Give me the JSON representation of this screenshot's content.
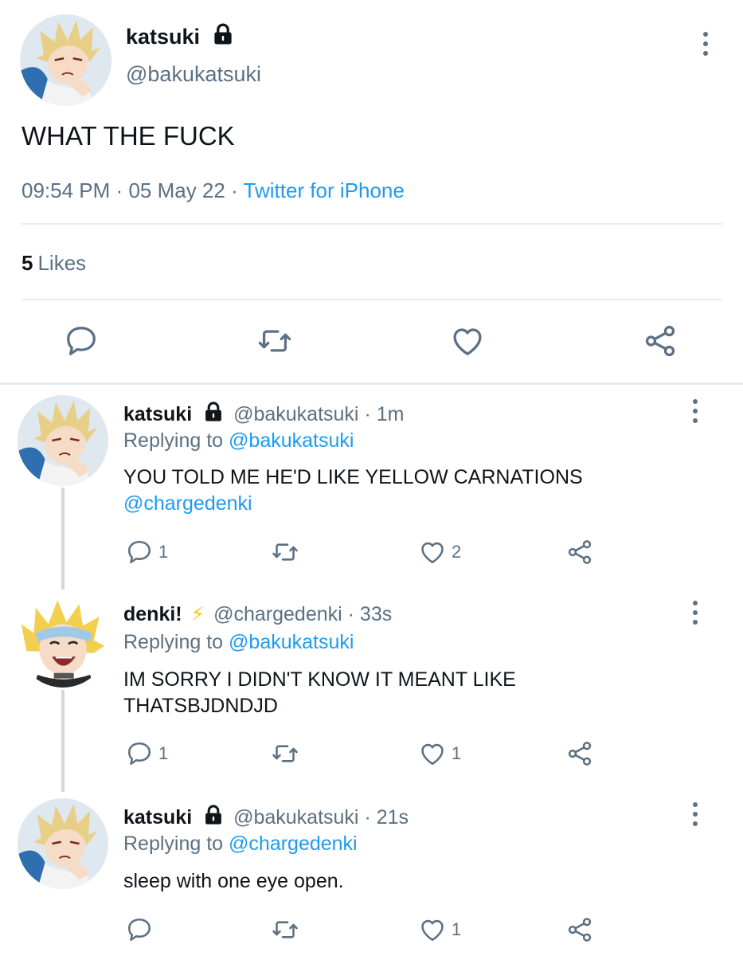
{
  "main_tweet": {
    "name": "katsuki",
    "handle": "@bakukatsuki",
    "text": "WHAT THE FUCK",
    "time": "09:54 PM",
    "date": "05 May 22",
    "client": "Twitter for iPhone",
    "likes_count": "5",
    "likes_label": "Likes"
  },
  "replies": [
    {
      "name": "katsuki",
      "handle": "@bakukatsuki",
      "age": "1m",
      "replying_label": "Replying to",
      "replying_to": "@bakukatsuki",
      "text": "YOU TOLD ME HE'D LIKE YELLOW CARNATIONS",
      "mention": "@chargedenki",
      "reply_count": "1",
      "like_count": "2"
    },
    {
      "name": "denki!",
      "emoji": "⚡",
      "handle": "@chargedenki",
      "age": "33s",
      "replying_label": "Replying to",
      "replying_to": "@bakukatsuki",
      "text_line1": "IM SORRY I DIDN'T KNOW IT MEANT LIKE",
      "text_line2": "THATSBJDNDJD",
      "reply_count": "1",
      "like_count": "1"
    },
    {
      "name": "katsuki",
      "handle": "@bakukatsuki",
      "age": "21s",
      "replying_label": "Replying to",
      "replying_to": "@chargedenki",
      "text": "sleep with one eye open.",
      "like_count": "1"
    }
  ],
  "separator": "·",
  "icons": {
    "more": "more-vertical-icon",
    "lock": "lock-icon",
    "reply": "reply-icon",
    "retweet": "retweet-icon",
    "like": "heart-icon",
    "share": "share-icon"
  },
  "colors": {
    "accent": "#1d9bf0",
    "muted": "#5b7083",
    "text": "#0f1419",
    "divider": "#e6ecf0",
    "emoji": "#f7c325"
  }
}
